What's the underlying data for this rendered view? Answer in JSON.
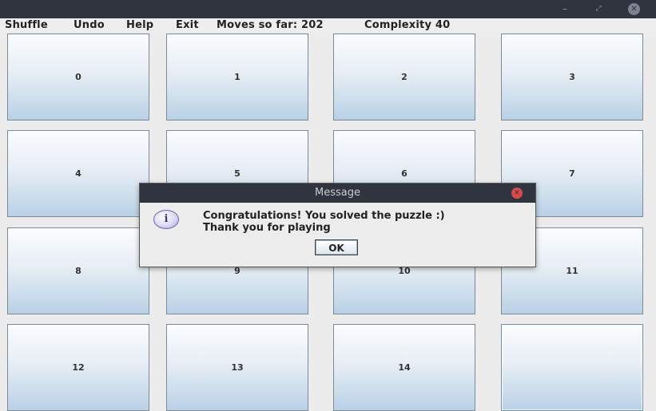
{
  "window": {
    "controls": {
      "minimize_glyph": "–",
      "maximize_glyph": "⤢",
      "close_glyph": "✕"
    }
  },
  "menu": {
    "items": [
      {
        "label": "Shuffle"
      },
      {
        "label": "Undo"
      },
      {
        "label": "Help"
      },
      {
        "label": "Exit"
      }
    ],
    "moves": "Moves so far: 202",
    "complexity": "Complexity 40"
  },
  "board": {
    "tiles": [
      "0",
      "1",
      "2",
      "3",
      "4",
      "5",
      "6",
      "7",
      "8",
      "9",
      "10",
      "11",
      "12",
      "13",
      "14",
      ""
    ]
  },
  "dialog": {
    "title": "Message",
    "icon": "info-icon",
    "icon_glyph": "i",
    "message_line1": "Congratulations! You solved the puzzle :)",
    "message_line2": "Thank you for playing",
    "ok_label": "OK",
    "close_glyph": "✕"
  },
  "colors": {
    "titlebar": "#2f343f",
    "tile_top": "#fbfcfd",
    "tile_bottom": "#b9d1e6",
    "close_red": "#d64b4b"
  }
}
